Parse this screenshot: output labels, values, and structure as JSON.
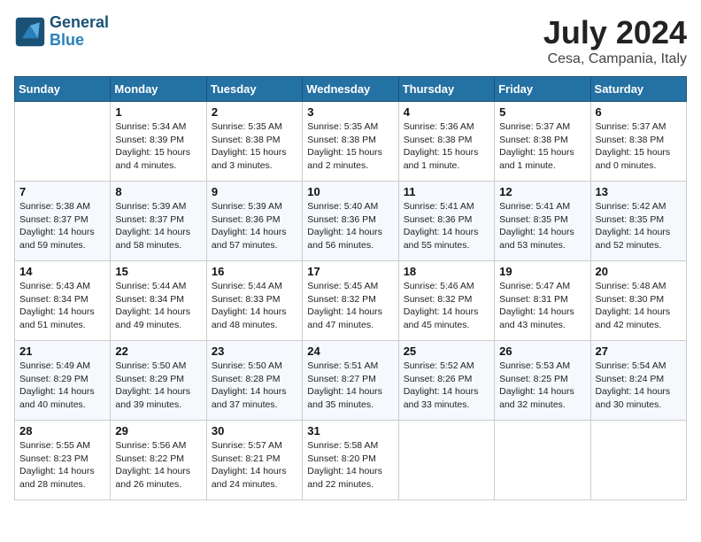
{
  "header": {
    "logo_line1": "General",
    "logo_line2": "Blue",
    "month": "July 2024",
    "location": "Cesa, Campania, Italy"
  },
  "days_of_week": [
    "Sunday",
    "Monday",
    "Tuesday",
    "Wednesday",
    "Thursday",
    "Friday",
    "Saturday"
  ],
  "weeks": [
    [
      {
        "day": "",
        "info": ""
      },
      {
        "day": "1",
        "info": "Sunrise: 5:34 AM\nSunset: 8:39 PM\nDaylight: 15 hours\nand 4 minutes."
      },
      {
        "day": "2",
        "info": "Sunrise: 5:35 AM\nSunset: 8:38 PM\nDaylight: 15 hours\nand 3 minutes."
      },
      {
        "day": "3",
        "info": "Sunrise: 5:35 AM\nSunset: 8:38 PM\nDaylight: 15 hours\nand 2 minutes."
      },
      {
        "day": "4",
        "info": "Sunrise: 5:36 AM\nSunset: 8:38 PM\nDaylight: 15 hours\nand 1 minute."
      },
      {
        "day": "5",
        "info": "Sunrise: 5:37 AM\nSunset: 8:38 PM\nDaylight: 15 hours\nand 1 minute."
      },
      {
        "day": "6",
        "info": "Sunrise: 5:37 AM\nSunset: 8:38 PM\nDaylight: 15 hours\nand 0 minutes."
      }
    ],
    [
      {
        "day": "7",
        "info": "Sunrise: 5:38 AM\nSunset: 8:37 PM\nDaylight: 14 hours\nand 59 minutes."
      },
      {
        "day": "8",
        "info": "Sunrise: 5:39 AM\nSunset: 8:37 PM\nDaylight: 14 hours\nand 58 minutes."
      },
      {
        "day": "9",
        "info": "Sunrise: 5:39 AM\nSunset: 8:36 PM\nDaylight: 14 hours\nand 57 minutes."
      },
      {
        "day": "10",
        "info": "Sunrise: 5:40 AM\nSunset: 8:36 PM\nDaylight: 14 hours\nand 56 minutes."
      },
      {
        "day": "11",
        "info": "Sunrise: 5:41 AM\nSunset: 8:36 PM\nDaylight: 14 hours\nand 55 minutes."
      },
      {
        "day": "12",
        "info": "Sunrise: 5:41 AM\nSunset: 8:35 PM\nDaylight: 14 hours\nand 53 minutes."
      },
      {
        "day": "13",
        "info": "Sunrise: 5:42 AM\nSunset: 8:35 PM\nDaylight: 14 hours\nand 52 minutes."
      }
    ],
    [
      {
        "day": "14",
        "info": "Sunrise: 5:43 AM\nSunset: 8:34 PM\nDaylight: 14 hours\nand 51 minutes."
      },
      {
        "day": "15",
        "info": "Sunrise: 5:44 AM\nSunset: 8:34 PM\nDaylight: 14 hours\nand 49 minutes."
      },
      {
        "day": "16",
        "info": "Sunrise: 5:44 AM\nSunset: 8:33 PM\nDaylight: 14 hours\nand 48 minutes."
      },
      {
        "day": "17",
        "info": "Sunrise: 5:45 AM\nSunset: 8:32 PM\nDaylight: 14 hours\nand 47 minutes."
      },
      {
        "day": "18",
        "info": "Sunrise: 5:46 AM\nSunset: 8:32 PM\nDaylight: 14 hours\nand 45 minutes."
      },
      {
        "day": "19",
        "info": "Sunrise: 5:47 AM\nSunset: 8:31 PM\nDaylight: 14 hours\nand 43 minutes."
      },
      {
        "day": "20",
        "info": "Sunrise: 5:48 AM\nSunset: 8:30 PM\nDaylight: 14 hours\nand 42 minutes."
      }
    ],
    [
      {
        "day": "21",
        "info": "Sunrise: 5:49 AM\nSunset: 8:29 PM\nDaylight: 14 hours\nand 40 minutes."
      },
      {
        "day": "22",
        "info": "Sunrise: 5:50 AM\nSunset: 8:29 PM\nDaylight: 14 hours\nand 39 minutes."
      },
      {
        "day": "23",
        "info": "Sunrise: 5:50 AM\nSunset: 8:28 PM\nDaylight: 14 hours\nand 37 minutes."
      },
      {
        "day": "24",
        "info": "Sunrise: 5:51 AM\nSunset: 8:27 PM\nDaylight: 14 hours\nand 35 minutes."
      },
      {
        "day": "25",
        "info": "Sunrise: 5:52 AM\nSunset: 8:26 PM\nDaylight: 14 hours\nand 33 minutes."
      },
      {
        "day": "26",
        "info": "Sunrise: 5:53 AM\nSunset: 8:25 PM\nDaylight: 14 hours\nand 32 minutes."
      },
      {
        "day": "27",
        "info": "Sunrise: 5:54 AM\nSunset: 8:24 PM\nDaylight: 14 hours\nand 30 minutes."
      }
    ],
    [
      {
        "day": "28",
        "info": "Sunrise: 5:55 AM\nSunset: 8:23 PM\nDaylight: 14 hours\nand 28 minutes."
      },
      {
        "day": "29",
        "info": "Sunrise: 5:56 AM\nSunset: 8:22 PM\nDaylight: 14 hours\nand 26 minutes."
      },
      {
        "day": "30",
        "info": "Sunrise: 5:57 AM\nSunset: 8:21 PM\nDaylight: 14 hours\nand 24 minutes."
      },
      {
        "day": "31",
        "info": "Sunrise: 5:58 AM\nSunset: 8:20 PM\nDaylight: 14 hours\nand 22 minutes."
      },
      {
        "day": "",
        "info": ""
      },
      {
        "day": "",
        "info": ""
      },
      {
        "day": "",
        "info": ""
      }
    ]
  ]
}
